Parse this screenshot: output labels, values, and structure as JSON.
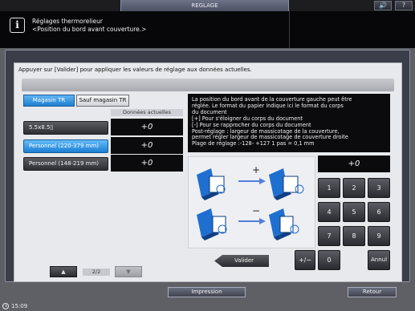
{
  "window": {
    "title": "REGLAGE"
  },
  "header": {
    "volume_icon": "speaker-icon",
    "volume_glyph": "🔊",
    "help_icon": "help-icon",
    "help_glyph": "?"
  },
  "message": {
    "icon": "info-icon",
    "icon_glyph": "i",
    "line1": "Réglages thermorelieur",
    "line2": "<Position du bord avant couverture.>"
  },
  "instruction": "Appuyer sur [Valider] pour appliquer les valeurs de réglage aux données actuelles.",
  "tabs": [
    {
      "label": "Magasin TR",
      "selected": true
    },
    {
      "label": "Sauf magasin TR",
      "selected": false
    }
  ],
  "column_header": "Données actuelles",
  "rows": [
    {
      "label": "5.5x8.5▯",
      "value": "+0",
      "selected": false
    },
    {
      "label": "Personnel (220-379 mm)",
      "value": "+0",
      "selected": true
    },
    {
      "label": "Personnel (148-219 mm)",
      "value": "+0",
      "selected": false
    }
  ],
  "description": [
    "La position du bord avant de la couverture gauche peut être",
    "réglée. Le format du papier indique ici le format du corps",
    "du document",
    "[+] Pour s'éloigner du corps du document",
    "[-] Pour se rapprocher du corps du document",
    "Post-réglage : largeur de massicotage de la couverture,",
    "permet régler largeur de massicotage de couverture droite",
    "Plage de réglage :-128- +127 1 pas = 0,1 mm"
  ],
  "illustration": {
    "plus_sign": "+",
    "minus_sign": "−",
    "accent_blue": "#1f6fd0",
    "arrow_color": "#4f7fe0"
  },
  "keypad": {
    "display": "+0",
    "keys": [
      "1",
      "2",
      "3",
      "4",
      "5",
      "6",
      "7",
      "8",
      "9",
      "0"
    ],
    "plus_minus": "+/−",
    "annul": "Annul"
  },
  "valider_label": "Valider",
  "pagination": {
    "up_glyph": "▲",
    "down_glyph": "▼",
    "indicator": "2/2"
  },
  "footer": {
    "impression": "Impression",
    "retour": "Retour",
    "clock_icon": "clock-icon",
    "time": "15:09"
  },
  "colors": {
    "selected_blue": "#1f7fd0",
    "display_black": "#0b0b0d",
    "panel": "#e8e9ec"
  }
}
